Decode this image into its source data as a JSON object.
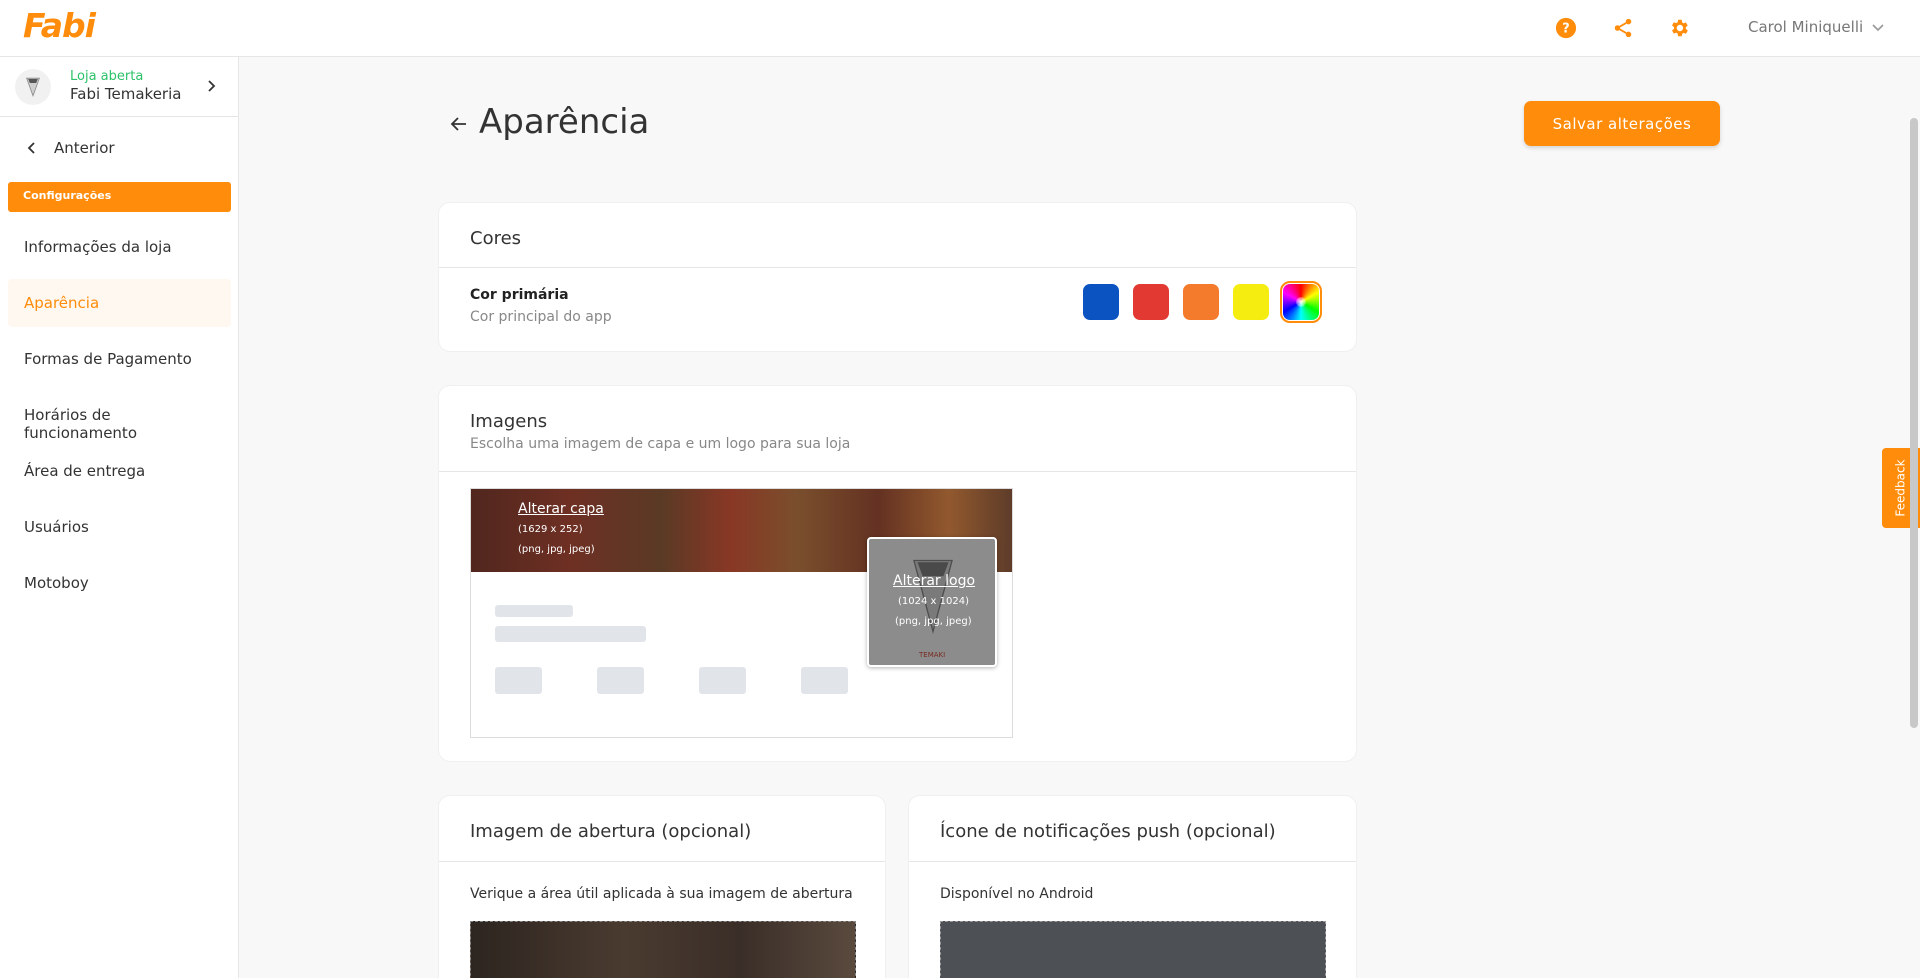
{
  "brand": {
    "name": "Fabi",
    "accent": "#ff8c0a"
  },
  "header": {
    "icons": [
      "help-icon",
      "share-icon",
      "gear-icon"
    ],
    "user_name": "Carol Miniquelli"
  },
  "store": {
    "status": "Loja aberta",
    "name": "Fabi Temakeria"
  },
  "sidebar": {
    "back_label": "Anterior",
    "section_label": "Configurações",
    "items": [
      {
        "label": "Informações da loja",
        "active": false
      },
      {
        "label": "Aparência",
        "active": true
      },
      {
        "label": "Formas de Pagamento",
        "active": false
      },
      {
        "label": "Horários de funcionamento",
        "active": false
      },
      {
        "label": "Área de entrega",
        "active": false
      },
      {
        "label": "Usuários",
        "active": false
      },
      {
        "label": "Motoboy",
        "active": false
      }
    ]
  },
  "page": {
    "title": "Aparência",
    "save_label": "Salvar alterações"
  },
  "colors_card": {
    "title": "Cores",
    "field_label": "Cor primária",
    "field_hint": "Cor principal do app",
    "swatches": [
      "#0b53c1",
      "#e23a33",
      "#f57b2c",
      "#f5ec10",
      "rainbow"
    ],
    "selected_index": 4
  },
  "images_card": {
    "title": "Imagens",
    "subtitle": "Escolha uma imagem de capa e um logo para sua loja",
    "cover_link": "Alterar capa",
    "cover_size": "(1629 x 252)",
    "cover_formats": "(png, jpg, jpeg)",
    "logo_link": "Alterar logo",
    "logo_size": "(1024 x 1024)",
    "logo_formats": "(png, jpg, jpeg)",
    "logo_brand_text": "TEMAKI"
  },
  "splash_card": {
    "title": "Imagem de abertura (opcional)",
    "hint": "Verique a área útil aplicada à sua imagem de abertura"
  },
  "push_card": {
    "title": "Ícone de notificações push (opcional)",
    "hint": "Disponível no Android"
  },
  "feedback_label": "Feedback"
}
